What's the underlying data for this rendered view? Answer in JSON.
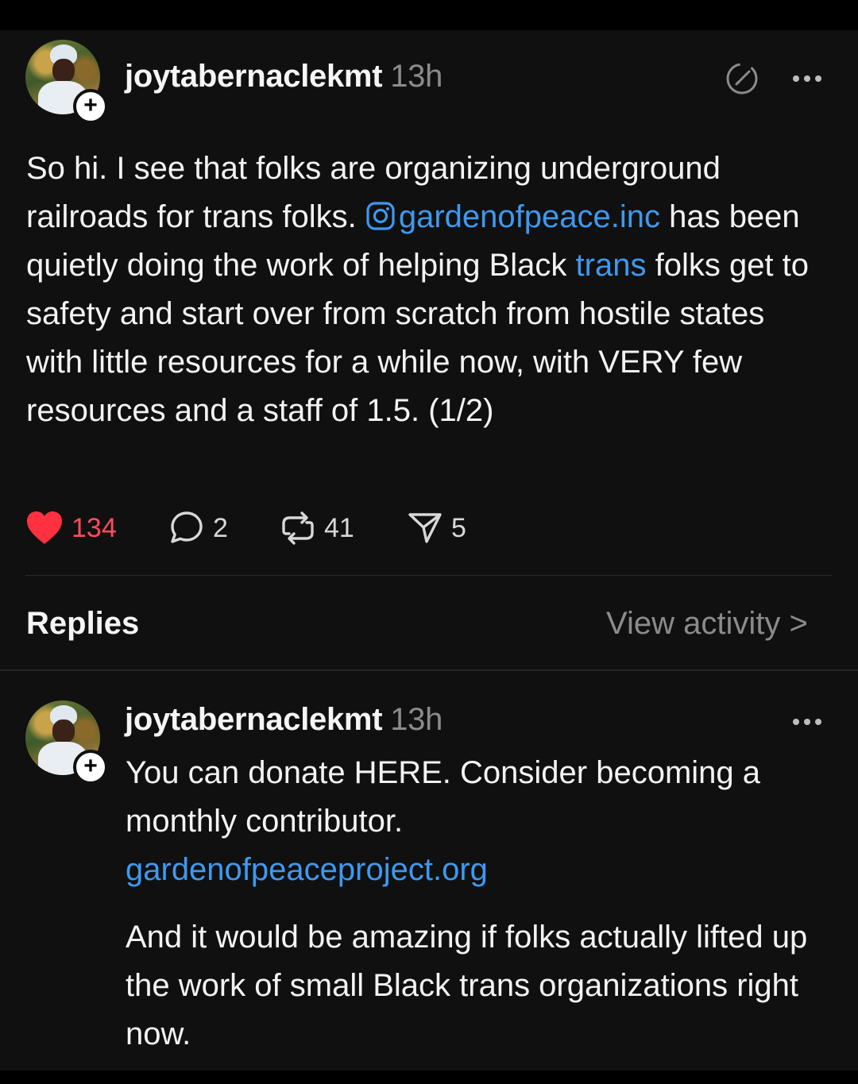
{
  "post": {
    "username": "joytabernaclekmt",
    "time": "13h",
    "text_1": "So hi. I see that folks are organizing underground railroads for trans folks. ",
    "mention": "gardenofpeace.inc",
    "text_2": " has been quietly doing the work of helping Black ",
    "link_trans": "trans",
    "text_3": " folks get to safety and start over from scratch from hostile states with little resources for a while now, with VERY few resources and a staff of 1.5. (1/2)",
    "likes": "134",
    "replies": "2",
    "reposts": "41",
    "shares": "5"
  },
  "section": {
    "replies_label": "Replies",
    "view_activity": "View activity",
    "chevron": ">"
  },
  "reply": {
    "username": "joytabernaclekmt",
    "time": "13h",
    "text_1": "You can donate HERE. Consider becoming a monthly contributor.",
    "link": "gardenofpeaceproject.org",
    "text_2": "And it would be amazing if folks actually lifted up the work of small Black trans organizations right now."
  },
  "icons": {
    "badge": "plus-icon",
    "edited": "edit-icon",
    "more": "more-icon",
    "like": "heart-icon",
    "comment": "comment-icon",
    "repost": "repost-icon",
    "share": "share-icon",
    "mention": "instagram-icon"
  },
  "colors": {
    "background": "#101010",
    "link": "#3e99f0",
    "like": "#ff3040",
    "muted": "#8b8b8b"
  }
}
